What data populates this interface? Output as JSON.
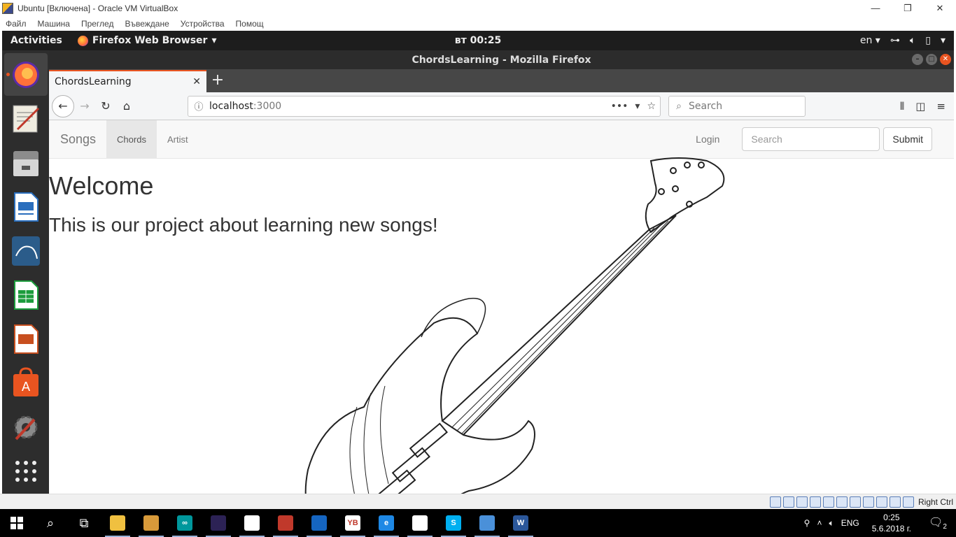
{
  "vbox": {
    "window_title": "Ubuntu [Включена] - Oracle VM VirtualBox",
    "menu": [
      "Файл",
      "Машина",
      "Преглед",
      "Въвеждане",
      "Устройства",
      "Помощ"
    ],
    "window_buttons": {
      "minimize": "—",
      "restore": "❐",
      "close": "✕"
    },
    "host_key_label": "Right Ctrl"
  },
  "ubuntu_topbar": {
    "activities": "Activities",
    "app_menu": "Firefox Web Browser",
    "clock": "вт 00:25",
    "language": "en"
  },
  "dock": {
    "items": [
      {
        "name": "firefox",
        "color": "#ff7139",
        "active": true
      },
      {
        "name": "text-editor",
        "color": "#e8e4d6"
      },
      {
        "name": "files",
        "color": "#9a9a9a"
      },
      {
        "name": "libreoffice-writer",
        "color": "#2a6ebd"
      },
      {
        "name": "mysql-workbench",
        "color": "#2b5c8a"
      },
      {
        "name": "libreoffice-calc",
        "color": "#1c9c3c"
      },
      {
        "name": "libreoffice-impress",
        "color": "#c84f1f"
      },
      {
        "name": "ubuntu-software",
        "color": "#e95420"
      },
      {
        "name": "system-settings",
        "color": "#6d6d6d"
      },
      {
        "name": "show-applications",
        "color": "#2d2d2d"
      }
    ]
  },
  "firefox": {
    "window_title": "ChordsLearning - Mozilla Firefox",
    "tab_title": "ChordsLearning",
    "url_host": "localhost",
    "url_port": ":3000",
    "search_placeholder": "Search"
  },
  "page": {
    "brand": "Songs",
    "nav_links": [
      "Chords",
      "Artist"
    ],
    "active_link": "Chords",
    "login": "Login",
    "search_placeholder": "Search",
    "submit": "Submit",
    "heading": "Welcome",
    "tagline": "This is our project about learning new songs!"
  },
  "taskbar": {
    "items": [
      {
        "name": "file-explorer",
        "color": "#f0c040",
        "label": ""
      },
      {
        "name": "archive",
        "color": "#d89a3a",
        "label": ""
      },
      {
        "name": "arduino",
        "color": "#00979c",
        "label": "∞"
      },
      {
        "name": "eclipse",
        "color": "#2c2255",
        "label": ""
      },
      {
        "name": "document",
        "color": "#ffffff",
        "label": ""
      },
      {
        "name": "popcorn-time",
        "color": "#c0392b",
        "label": ""
      },
      {
        "name": "virtualbox",
        "color": "#1565c0",
        "label": ""
      },
      {
        "name": "yandex-browser",
        "color": "#ffffff",
        "label": "YB"
      },
      {
        "name": "edge",
        "color": "#1e88e5",
        "label": "e"
      },
      {
        "name": "sticky-notes",
        "color": "#ffffff",
        "label": ""
      },
      {
        "name": "skype",
        "color": "#00aff0",
        "label": "S"
      },
      {
        "name": "photos",
        "color": "#4a90d9",
        "label": ""
      },
      {
        "name": "word",
        "color": "#2b579a",
        "label": "W"
      }
    ],
    "language": "ENG",
    "time": "0:25",
    "date": "5.6.2018 г.",
    "notification_count": "2"
  }
}
